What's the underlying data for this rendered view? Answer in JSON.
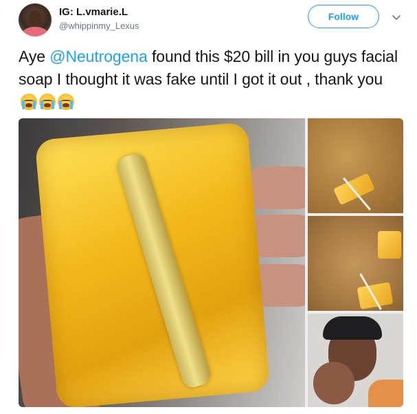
{
  "tweet": {
    "display_name": "IG: L.vmarie.L",
    "handle": "@whippinmy_Lexus",
    "follow_label": "Follow",
    "text_before_mention": "Aye ",
    "mention": "@Neutrogena",
    "text_after_mention": " found this $20 bill in you guys facial soap I thought it was fake until I got it out , thank you",
    "emojis": [
      "loudly-crying-face",
      "loudly-crying-face",
      "loudly-crying-face"
    ]
  },
  "colors": {
    "accent": "#1da1f2",
    "text": "#14171a",
    "secondary_text": "#657786"
  },
  "icons": {
    "caret": "chevron-down-icon"
  }
}
